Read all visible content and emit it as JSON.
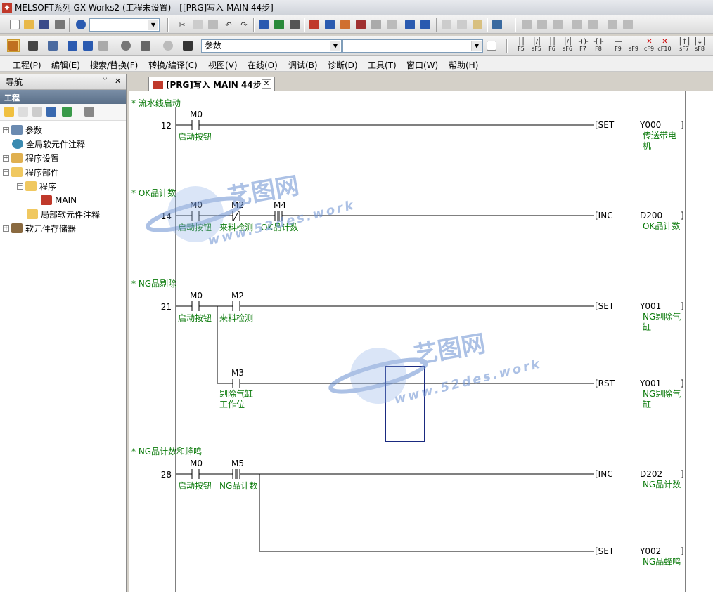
{
  "window": {
    "title": "MELSOFT系列 GX Works2 (工程未设置) - [[PRG]写入 MAIN 44步]",
    "icon": "mitsubishi-app-icon"
  },
  "toolbar2": {
    "combo_value": "参数"
  },
  "menu": [
    "工程(P)",
    "编辑(E)",
    "搜索/替换(F)",
    "转换/编译(C)",
    "视图(V)",
    "在线(O)",
    "调试(B)",
    "诊断(D)",
    "工具(T)",
    "窗口(W)",
    "帮助(H)"
  ],
  "fkeys": [
    {
      "sym": "┤├",
      "lb": "F5"
    },
    {
      "sym": "┤/├",
      "lb": "sF5"
    },
    {
      "sym": "┤├",
      "lb": "F6"
    },
    {
      "sym": "┤/├",
      "lb": "sF6"
    },
    {
      "sym": "-( )-",
      "lb": "F7"
    },
    {
      "sym": "-[ ]-",
      "lb": "F8"
    },
    {
      "sym": "—",
      "lb": "F9"
    },
    {
      "sym": "|",
      "lb": "sF9"
    },
    {
      "sym": "✕",
      "lb": "cF9"
    },
    {
      "sym": "✕",
      "lb": "cF10"
    },
    {
      "sym": "┤↑├",
      "lb": "sF7"
    },
    {
      "sym": "┤↓├",
      "lb": "sF8"
    }
  ],
  "nav": {
    "title": "导航",
    "pin": "ᛘ",
    "close": "✕",
    "section": "工程",
    "items": [
      {
        "label": "参数",
        "exp": "+"
      },
      {
        "label": "全局软元件注释",
        "exp": ""
      },
      {
        "label": "程序设置",
        "exp": "+"
      },
      {
        "label": "程序部件",
        "exp": "−"
      },
      {
        "label": "程序",
        "exp": "−"
      },
      {
        "label": "MAIN",
        "exp": ""
      },
      {
        "label": "局部软元件注释",
        "exp": ""
      },
      {
        "label": "软元件存储器",
        "exp": "+"
      }
    ]
  },
  "tab": {
    "label": "[PRG]写入 MAIN 44步",
    "close": "✕"
  },
  "ladder": {
    "comments": [
      "* 流水线启动",
      "* OK品计数",
      "* NG品剔除",
      "* NG品计数和蜂鸣"
    ],
    "steps": [
      "12",
      "14",
      "21",
      "28"
    ],
    "contacts": [
      {
        "dev": "M0",
        "lbl": "启动按钮"
      },
      {
        "dev": "M0",
        "lbl": "启动按钮"
      },
      {
        "dev": "M2",
        "lbl": "来料检测"
      },
      {
        "dev": "M4",
        "lbl": "OK品计数"
      },
      {
        "dev": "M0",
        "lbl": "启动按钮"
      },
      {
        "dev": "M2",
        "lbl": "来料检测"
      },
      {
        "dev": "M3",
        "lbl": "剔除气缸\n工作位"
      },
      {
        "dev": "M0",
        "lbl": "启动按钮"
      },
      {
        "dev": "M5",
        "lbl": "NG品计数"
      }
    ],
    "instructions": [
      {
        "op": "[SET",
        "dev": "Y000",
        "lbl": "传送带电\n机"
      },
      {
        "op": "[INC",
        "dev": "D200",
        "lbl": "OK品计数"
      },
      {
        "op": "[SET",
        "dev": "Y001",
        "lbl": "NG剔除气\n缸"
      },
      {
        "op": "[RST",
        "dev": "Y001",
        "lbl": "NG剔除气\n缸"
      },
      {
        "op": "[INC",
        "dev": "D202",
        "lbl": "NG品计数"
      },
      {
        "op": "[SET",
        "dev": "Y002",
        "lbl": "NG品蜂鸣"
      }
    ],
    "bracket": "]"
  },
  "watermark": {
    "text_cn": "艺图网",
    "text_en": "www.52des.work",
    "color": "#6a8fd0"
  }
}
